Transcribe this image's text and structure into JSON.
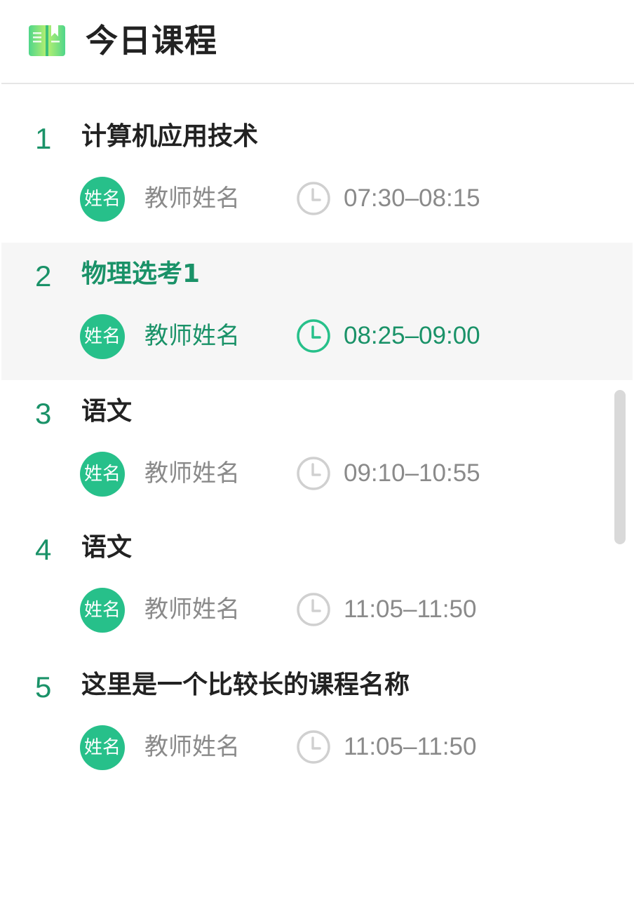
{
  "header": {
    "title": "今日课程",
    "icon": "book-icon",
    "accent_color": "#27c08a"
  },
  "courses": [
    {
      "index": "1",
      "name": "计算机应用技术",
      "avatar": "姓名",
      "teacher": "教师姓名",
      "time": "07:30–08:15",
      "active": false
    },
    {
      "index": "2",
      "name": "物理选考1",
      "avatar": "姓名",
      "teacher": "教师姓名",
      "time": "08:25–09:00",
      "active": true
    },
    {
      "index": "3",
      "name": "语文",
      "avatar": "姓名",
      "teacher": "教师姓名",
      "time": "09:10–10:55",
      "active": false
    },
    {
      "index": "4",
      "name": "语文",
      "avatar": "姓名",
      "teacher": "教师姓名",
      "time": "11:05–11:50",
      "active": false
    },
    {
      "index": "5",
      "name": "这里是一个比较长的课程名称",
      "avatar": "姓名",
      "teacher": "教师姓名",
      "time": "11:05–11:50",
      "active": false
    }
  ],
  "colors": {
    "active_text": "#1a9268",
    "avatar_bg": "#27c08a",
    "muted_text": "#8a8a8a",
    "active_row_bg": "#f6f6f6"
  }
}
